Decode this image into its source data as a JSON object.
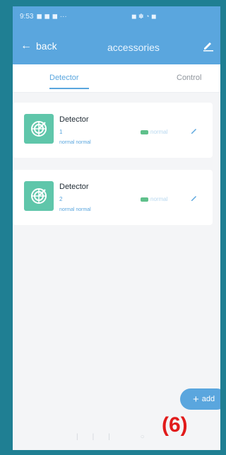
{
  "statusbar": {
    "time": "9:53",
    "left_icons": "◼ ◼ ◼ ···",
    "right_icons": "◼ ✽ ◔ ◼"
  },
  "appbar": {
    "back_label": "back",
    "title": "accessories"
  },
  "tabs": [
    {
      "label": "Detector",
      "active": true
    },
    {
      "label": "Control",
      "active": false
    }
  ],
  "devices": [
    {
      "name": "Detector",
      "number": "1",
      "subtext": "normal normal",
      "status": "normal"
    },
    {
      "name": "Detector",
      "number": "2",
      "subtext": "normal normal",
      "status": "normal"
    }
  ],
  "actions": {
    "add_label": "add"
  },
  "annotation": {
    "label": "(6)"
  },
  "colors": {
    "accent": "#5aa6de",
    "device_icon": "#5fc6aa",
    "battery": "#5fc08b",
    "page_background": "#1f7f93"
  }
}
